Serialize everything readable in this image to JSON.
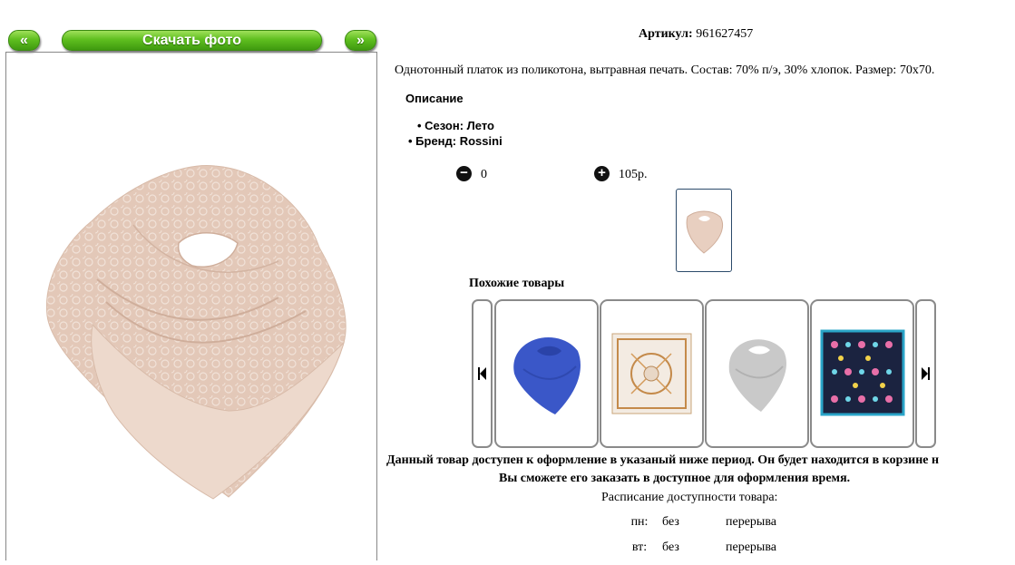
{
  "nav": {
    "prev": "«",
    "download": "Скачать фото",
    "next": "»"
  },
  "product": {
    "sku_label": "Артикул:",
    "sku_value": "961627457",
    "summary": "Однотонный платок из поликотона, вытравная печать. Состав: 70% п/э, 30% хлопок. Размер: 70х70.",
    "description_heading": "Описание",
    "properties": [
      "Сезон: Лето",
      "Бренд: Rossini"
    ],
    "quantity": "0",
    "price": "105р."
  },
  "similar": {
    "heading": "Похожие товары",
    "items": [
      "blue scarf",
      "beige square scarf",
      "grey scarf",
      "dark patterned scarf"
    ]
  },
  "availability": {
    "notice_line1": "Данный товар доступен к оформление в указаный ниже период. Он будет находится в корзине н",
    "notice_line2": "Вы сможете его заказать в доступное для оформления время.",
    "schedule_title": "Расписание доступности товара:",
    "schedule": [
      {
        "day": "пн:",
        "from": "без",
        "to": "перерыва"
      },
      {
        "day": "вт:",
        "from": "без",
        "to": "перерыва"
      }
    ]
  },
  "colors": {
    "accent_green": "#5fbf1f",
    "scarf_pink": "#e8cfc0"
  }
}
